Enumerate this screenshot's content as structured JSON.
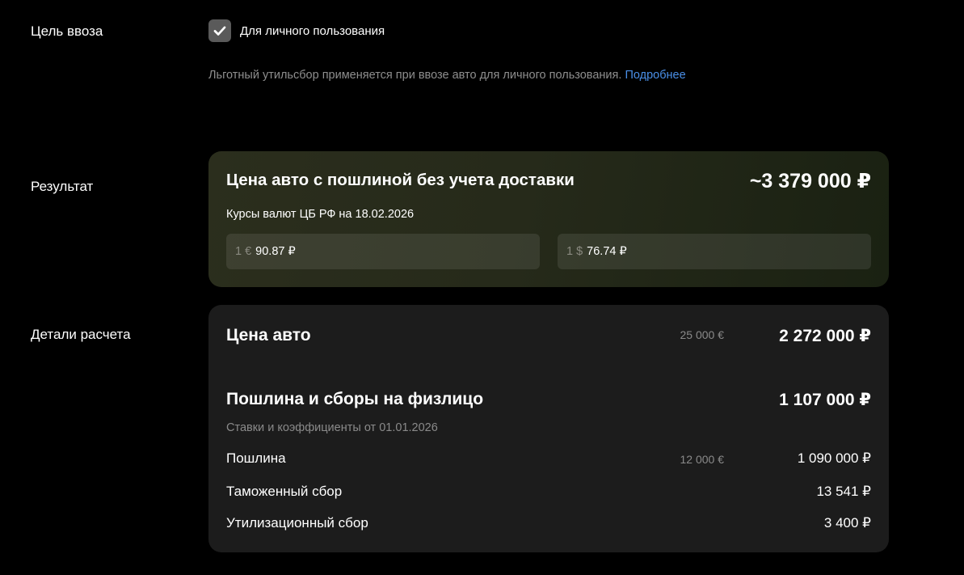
{
  "purpose": {
    "label": "Цель ввоза",
    "checkbox_label": "Для личного пользования",
    "checked": true,
    "hint_text": "Льготный утильсбор применяется при ввозе авто для личного пользования.",
    "hint_link": "Подробнее"
  },
  "result": {
    "label": "Результат",
    "title": "Цена авто с пошлиной без учета доставки",
    "total": "~3 379 000 ₽",
    "rates_caption": "Курсы валют ЦБ РФ на 18.02.2026",
    "eur": {
      "unit": "1 €",
      "value": "90.87 ₽"
    },
    "usd": {
      "unit": "1 $",
      "value": "76.74 ₽"
    }
  },
  "details": {
    "label": "Детали расчета",
    "car_price": {
      "name": "Цена авто",
      "eur": "25 000 €",
      "rub": "2 272 000 ₽"
    },
    "fees": {
      "name": "Пошлина и сборы на физлицо",
      "rub": "1 107 000 ₽"
    },
    "rates_date": "Ставки и коэффициенты от 01.01.2026",
    "items": [
      {
        "name": "Пошлина",
        "eur": "12 000 €",
        "rub": "1 090 000 ₽"
      },
      {
        "name": "Таможенный сбор",
        "rub": "13 541 ₽"
      },
      {
        "name": "Утилизационный сбор",
        "rub": "3 400 ₽"
      }
    ]
  }
}
